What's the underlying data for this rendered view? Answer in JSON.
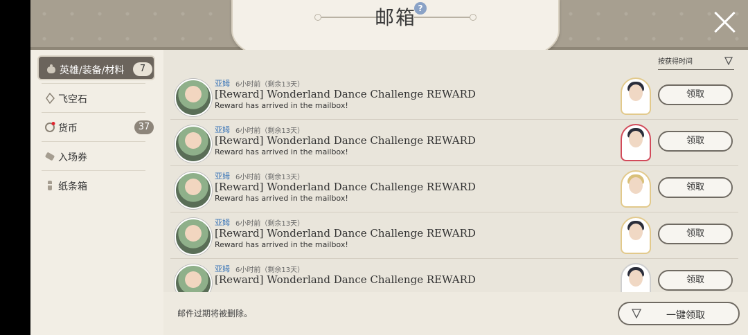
{
  "window": {
    "title": "邮箱",
    "help_icon": "?",
    "close_icon": "close-icon"
  },
  "sidebar": {
    "items": [
      {
        "label": "英雄/装备/材料",
        "badge": "7",
        "active": true,
        "icon": "pouch-icon"
      },
      {
        "label": "飞空石",
        "badge": "",
        "active": false,
        "icon": "crystal-icon"
      },
      {
        "label": "货币",
        "badge": "37",
        "active": false,
        "icon": "coin-icon"
      },
      {
        "label": "入场券",
        "badge": "",
        "active": false,
        "icon": "ticket-icon"
      },
      {
        "label": "纸条箱",
        "badge": "",
        "active": false,
        "icon": "scroll-icon"
      }
    ]
  },
  "sort": {
    "label": "按获得时间",
    "icon": "filter-icon"
  },
  "mails": [
    {
      "sender": "亚姆",
      "time": "6小时前（剩余13天）",
      "subject": "[Reward] Wonderland Dance Challenge REWARD",
      "preview": "Reward has arrived in the mailbox!",
      "claim": "领取"
    },
    {
      "sender": "亚姆",
      "time": "6小时前（剩余13天）",
      "subject": "[Reward] Wonderland Dance Challenge REWARD",
      "preview": "Reward has arrived in the mailbox!",
      "claim": "领取"
    },
    {
      "sender": "亚姆",
      "time": "6小时前（剩余13天）",
      "subject": "[Reward] Wonderland Dance Challenge REWARD",
      "preview": "Reward has arrived in the mailbox!",
      "claim": "领取"
    },
    {
      "sender": "亚姆",
      "time": "6小时前（剩余13天）",
      "subject": "[Reward] Wonderland Dance Challenge REWARD",
      "preview": "Reward has arrived in the mailbox!",
      "claim": "领取"
    },
    {
      "sender": "亚姆",
      "time": "6小时前（剩余13天）",
      "subject": "[Reward] Wonderland Dance Challenge REWARD",
      "preview": "",
      "claim": "领取"
    }
  ],
  "footer": {
    "note": "邮件过期将被删除。",
    "claim_all": "一键领取",
    "claim_all_icon": "filter-icon"
  }
}
